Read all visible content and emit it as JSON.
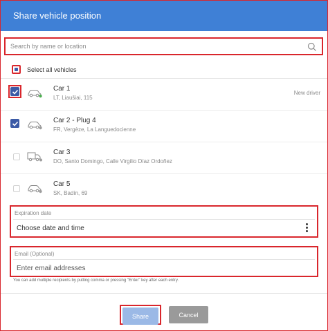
{
  "dialog": {
    "title": "Share vehicle position"
  },
  "search": {
    "placeholder": "Search by name or location",
    "value": ""
  },
  "select_all": {
    "label": "Select all vehicles",
    "state": "indeterminate"
  },
  "vehicles": [
    {
      "name": "Car 1",
      "location": "LT, Liaušiai, 115",
      "badge": "New driver",
      "checked": true,
      "icon": "car-icon",
      "status_color": "#4caf50"
    },
    {
      "name": "Car 2 - Plug 4",
      "location": "FR, Vergèze, La Languedocienne",
      "badge": "",
      "checked": true,
      "icon": "car-icon",
      "status_color": "#9e9e9e"
    },
    {
      "name": "Car 3",
      "location": "DO, Santo Domingo, Calle Virgilio Díaz Ordoñez",
      "badge": "",
      "checked": false,
      "icon": "truck-icon",
      "status_color": "#9e9e9e"
    },
    {
      "name": "Car 5",
      "location": "SK, Badín, 69",
      "badge": "",
      "checked": false,
      "icon": "car-icon",
      "status_color": "#9e9e9e"
    }
  ],
  "expiration": {
    "label": "Expiration date",
    "value": "Choose date and time"
  },
  "email": {
    "label": "Email (Optional)",
    "placeholder": "Enter email addresses",
    "hint": "You can add multiple recipients by putting comma or pressing \"Enter\" key after each entry."
  },
  "buttons": {
    "share": "Share",
    "cancel": "Cancel"
  },
  "colors": {
    "header": "#3f80d6",
    "checkbox": "#3b5aa6",
    "highlight": "#d9262c",
    "share_button": "#9bb9e6",
    "cancel_button": "#9a9a9a"
  }
}
